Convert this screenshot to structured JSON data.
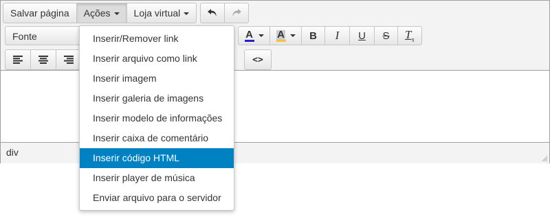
{
  "menubar": {
    "save_label": "Salvar página",
    "actions_label": "Ações",
    "store_label": "Loja virtual"
  },
  "toolbar": {
    "font_select_value": "Fonte",
    "text_color_glyph": "A",
    "bg_color_glyph": "A",
    "bold_glyph": "B",
    "italic_glyph": "I",
    "underline_glyph": "U",
    "strike_glyph": "S",
    "clear_format_glyph": "T",
    "clear_format_sub": "x",
    "code_glyph": "<>"
  },
  "colors": {
    "accent": "#0081c2",
    "text_color_bar": "#2222cc",
    "bg_color_bar": "#f5c242"
  },
  "actions_menu": {
    "items": [
      "Inserir/Remover link",
      "Inserir arquivo como link",
      "Inserir imagem",
      "Inserir galeria de imagens",
      "Inserir modelo de informações",
      "Inserir caixa de comentário",
      "Inserir código HTML",
      "Inserir player de música",
      "Enviar arquivo para o servidor"
    ],
    "selected_item": "Inserir código HTML"
  },
  "statusbar": {
    "path": "div"
  },
  "icons": {
    "undo": "undo-icon",
    "redo": "redo-icon",
    "align_left": "align-left-icon",
    "align_center": "align-center-icon",
    "align_right": "align-right-icon",
    "resize": "resize-handle-icon"
  }
}
